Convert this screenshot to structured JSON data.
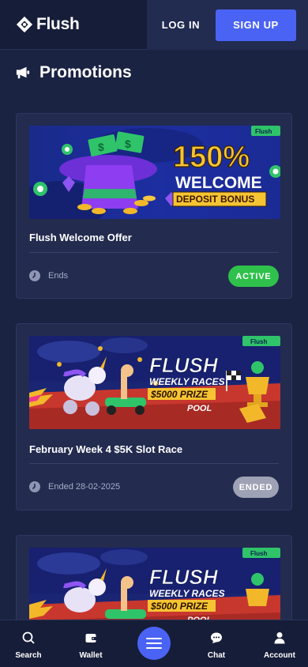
{
  "header": {
    "brand": "Flush",
    "login_label": "LOG IN",
    "signup_label": "SIGN UP"
  },
  "page": {
    "title": "Promotions"
  },
  "promotions": [
    {
      "title": "Flush Welcome Offer",
      "meta": "Ends",
      "status": "ACTIVE",
      "banner": {
        "logo": "Flush",
        "headline_1": "150%",
        "headline_2": "WELCOME",
        "headline_3": "DEPOSIT BONUS"
      }
    },
    {
      "title": "February Week 4 $5K Slot Race",
      "meta": "Ended 28-02-2025",
      "status": "ENDED",
      "banner": {
        "logo": "Flush",
        "headline_1": "FLUSH",
        "headline_2": "WEEKLY RACES",
        "headline_3": "$5000 PRIZE",
        "headline_4": "POOL"
      }
    },
    {
      "banner": {
        "logo": "Flush",
        "headline_1": "FLUSH",
        "headline_2": "WEEKLY RACES",
        "headline_3": "$5000 PRIZE",
        "headline_4": "POOL"
      }
    }
  ],
  "nav": {
    "search": "Search",
    "wallet": "Wallet",
    "menu": "menu-icon",
    "chat": "Chat",
    "account": "Account"
  },
  "colors": {
    "background": "#1b2343",
    "header": "#161d38",
    "card": "#232b4f",
    "primary": "#4a63f5",
    "active": "#2fc14b",
    "ended": "#9ea2b4"
  }
}
